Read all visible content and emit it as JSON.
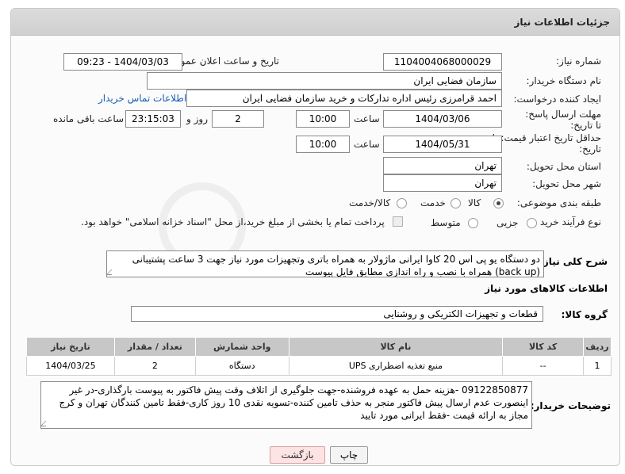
{
  "header": {
    "title": "جزئیات اطلاعات نیاز"
  },
  "fields": {
    "need_number_label": "شماره نیاز:",
    "need_number": "1104004068000029",
    "announce_label": "تاریخ و ساعت اعلان عمومی:",
    "announce_value": "1404/03/03 - 09:23",
    "buyer_label": "نام دستگاه خریدار:",
    "buyer_value": "سازمان فضایی ایران",
    "creator_label": "ایجاد کننده درخواست:",
    "creator_value": "احمد قرامرزی رئیس اداره تدارکات و خرید سازمان فضایی ایران",
    "contact_link": "اطلاعات تماس خریدار",
    "deadline_label": "مهلت ارسال پاسخ: تا تاریخ:",
    "deadline_date": "1404/03/06",
    "time_label": "ساعت",
    "deadline_time": "10:00",
    "days_value": "2",
    "days_label": "روز و",
    "remaining_time": "23:15:03",
    "remaining_label": "ساعت باقی مانده",
    "price_validity_label": "حداقل تاریخ اعتبار قیمت: تا تاریخ:",
    "price_validity_date": "1404/05/31",
    "price_validity_time": "10:00",
    "province_label": "استان محل تحویل:",
    "province_value": "تهران",
    "city_label": "شهر محل تحویل:",
    "city_value": "تهران",
    "category_label": "طبقه بندی موضوعی:",
    "category_options": [
      "کالا",
      "خدمت",
      "کالا/خدمت"
    ],
    "category_selected": "کالا",
    "process_label": "نوع فرآیند خرید :",
    "process_options": [
      "جزیی",
      "متوسط"
    ],
    "payment_note": "پرداخت تمام یا بخشی از مبلغ خرید،از محل \"اسناد خزانه اسلامی\" خواهد بود."
  },
  "description": {
    "label": "شرح کلی نیاز:",
    "text": "دو دستگاه یو پی اس 20 کاوا ایرانی ماژولار به همراه باتری وتجهیزات مورد نیاز جهت 3 ساعت پشتیبانی (back up) همراه با نصب و راه اندازی مطابق فایل پیوست"
  },
  "goods_section": {
    "title": "اطلاعات کالاهای مورد نیاز",
    "group_label": "گروه کالا:",
    "group_value": "قطعات و تجهیزات الکتریکی و روشنایی"
  },
  "table": {
    "headers": [
      "ردیف",
      "کد کالا",
      "نام کالا",
      "واحد شمارش",
      "تعداد / مقدار",
      "تاریخ نیاز"
    ],
    "rows": [
      [
        "1",
        "--",
        "منبع تغذیه اضطراری UPS",
        "دستگاه",
        "2",
        "1404/03/25"
      ]
    ]
  },
  "buyer_notes": {
    "label": "توضیحات خریدار:",
    "text": "09122850877 -هزینه حمل به عهده فروشنده-جهت جلوگیری از اتلاف وقت پیش فاکتور به پیوست بارگذاری-در غیر اینصورت عدم ارسال پیش فاکتور منجر به حذف تامین کننده-تسویه نقدی 10 روز کاری-فقط تامین کنندگان تهران و کرج مجاز به ارائه قیمت -فقط ایرانی مورد تایید"
  },
  "buttons": {
    "print": "چاپ",
    "back": "بازگشت"
  }
}
